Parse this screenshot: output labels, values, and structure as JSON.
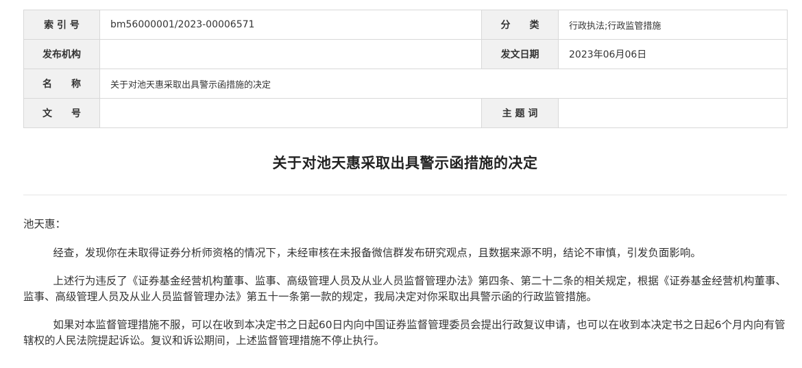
{
  "meta": {
    "index_label": "索 引 号",
    "index_value": "bm56000001/2023-00006571",
    "category_label": "分　　类",
    "category_value": "行政执法;行政监管措施",
    "publisher_label": "发布机构",
    "publisher_value": "",
    "date_label": "发文日期",
    "date_value": "2023年06月06日",
    "name_label": "名　　称",
    "name_value": "关于对池天惠采取出具警示函措施的决定",
    "docno_label": "文　　号",
    "docno_value": "",
    "keywords_label": "主 题 词",
    "keywords_value": ""
  },
  "document": {
    "title": "关于对池天惠采取出具警示函措施的决定",
    "salutation": "池天惠：",
    "paragraphs": [
      "经查，发现你在未取得证券分析师资格的情况下，未经审核在未报备微信群发布研究观点，且数据来源不明，结论不审慎，引发负面影响。",
      "上述行为违反了《证券基金经营机构董事、监事、高级管理人员及从业人员监督管理办法》第四条、第二十二条的相关规定，根据《证券基金经营机构董事、监事、高级管理人员及从业人员监督管理办法》第五十一条第一款的规定，我局决定对你采取出具警示函的行政监管措施。",
      "如果对本监督管理措施不服，可以在收到本决定书之日起60日内向中国证券监督管理委员会提出行政复议申请，也可以在收到本决定书之日起6个月内向有管辖权的人民法院提起诉讼。复议和诉讼期间，上述监督管理措施不停止执行。"
    ]
  }
}
